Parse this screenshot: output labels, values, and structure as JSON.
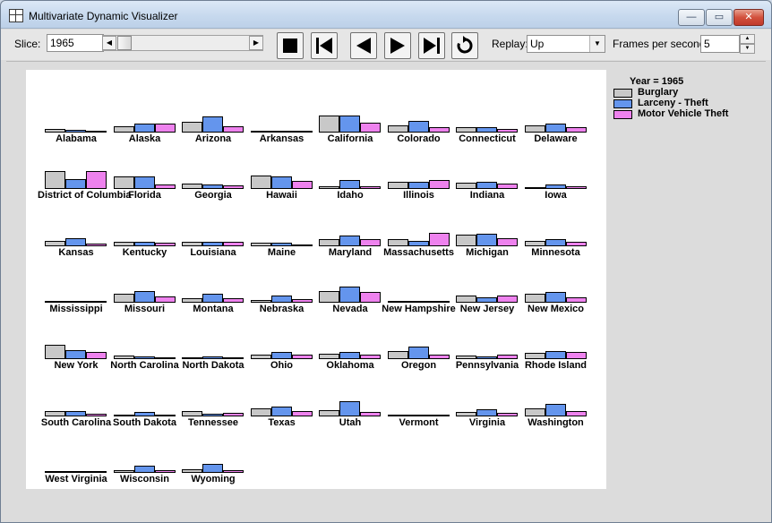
{
  "window": {
    "title": "Multivariate Dynamic Visualizer",
    "minimize_glyph": "—",
    "maximize_glyph": "▭",
    "close_glyph": "✕"
  },
  "toolbar": {
    "slice_label": "Slice:",
    "slice_value": "1965",
    "replay_label": "Replay:",
    "replay_value": "Up",
    "fps_label": "Frames per second:",
    "fps_value": "5",
    "buttons": [
      "stop",
      "first-frame",
      "step-back",
      "step-forward",
      "last-frame",
      "replay"
    ]
  },
  "legend": {
    "title": "Year = 1965",
    "items": [
      {
        "label": "Burglary",
        "color": "#c8c8c8"
      },
      {
        "label": "Larceny - Theft",
        "color": "#6495ed"
      },
      {
        "label": "Motor Vehicle Theft",
        "color": "#ee82ee"
      }
    ]
  },
  "chart_data": {
    "type": "bar",
    "note_series": [
      "Burglary",
      "Larceny - Theft",
      "Motor Vehicle Theft"
    ],
    "series_colors": [
      "#c8c8c8",
      "#6495ed",
      "#ee82ee"
    ],
    "scale_max": 1,
    "states": [
      {
        "name": "Alabama",
        "values": [
          0.22,
          0.16,
          0.05
        ]
      },
      {
        "name": "Alaska",
        "values": [
          0.36,
          0.52,
          0.48
        ]
      },
      {
        "name": "Arizona",
        "values": [
          0.58,
          0.88,
          0.36
        ]
      },
      {
        "name": "Arkansas",
        "values": [
          0.08,
          0.1,
          0.06
        ]
      },
      {
        "name": "California",
        "values": [
          0.95,
          0.95,
          0.55
        ]
      },
      {
        "name": "Colorado",
        "values": [
          0.4,
          0.64,
          0.28
        ]
      },
      {
        "name": "Connecticut",
        "values": [
          0.3,
          0.28,
          0.22
        ]
      },
      {
        "name": "Delaware",
        "values": [
          0.42,
          0.5,
          0.32
        ]
      },
      {
        "name": "District of Columbia",
        "values": [
          1.0,
          0.55,
          1.0
        ]
      },
      {
        "name": "Florida",
        "values": [
          0.72,
          0.72,
          0.26
        ]
      },
      {
        "name": "Georgia",
        "values": [
          0.32,
          0.26,
          0.2
        ]
      },
      {
        "name": "Hawaii",
        "values": [
          0.76,
          0.72,
          0.44
        ]
      },
      {
        "name": "Idaho",
        "values": [
          0.16,
          0.52,
          0.16
        ]
      },
      {
        "name": "Illinois",
        "values": [
          0.38,
          0.42,
          0.52
        ]
      },
      {
        "name": "Indiana",
        "values": [
          0.36,
          0.42,
          0.32
        ]
      },
      {
        "name": "Iowa",
        "values": [
          0.1,
          0.26,
          0.14
        ]
      },
      {
        "name": "Kansas",
        "values": [
          0.3,
          0.46,
          0.14
        ]
      },
      {
        "name": "Kentucky",
        "values": [
          0.26,
          0.26,
          0.18
        ]
      },
      {
        "name": "Louisiana",
        "values": [
          0.26,
          0.26,
          0.24
        ]
      },
      {
        "name": "Maine",
        "values": [
          0.2,
          0.2,
          0.06
        ]
      },
      {
        "name": "Maryland",
        "values": [
          0.42,
          0.62,
          0.38
        ]
      },
      {
        "name": "Massachusetts",
        "values": [
          0.38,
          0.32,
          0.76
        ]
      },
      {
        "name": "Michigan",
        "values": [
          0.66,
          0.7,
          0.44
        ]
      },
      {
        "name": "Minnesota",
        "values": [
          0.28,
          0.38,
          0.24
        ]
      },
      {
        "name": "Mississippi",
        "values": [
          0.08,
          0.06,
          0.04
        ]
      },
      {
        "name": "Missouri",
        "values": [
          0.5,
          0.64,
          0.34
        ]
      },
      {
        "name": "Montana",
        "values": [
          0.24,
          0.48,
          0.26
        ]
      },
      {
        "name": "Nebraska",
        "values": [
          0.16,
          0.42,
          0.18
        ]
      },
      {
        "name": "Nevada",
        "values": [
          0.66,
          0.9,
          0.58
        ]
      },
      {
        "name": "New Hampshire",
        "values": [
          0.1,
          0.1,
          0.06
        ]
      },
      {
        "name": "New Jersey",
        "values": [
          0.42,
          0.28,
          0.4
        ]
      },
      {
        "name": "New Mexico",
        "values": [
          0.48,
          0.6,
          0.3
        ]
      },
      {
        "name": "New York",
        "values": [
          0.8,
          0.48,
          0.38
        ]
      },
      {
        "name": "North Carolina",
        "values": [
          0.2,
          0.14,
          0.1
        ]
      },
      {
        "name": "North Dakota",
        "values": [
          0.06,
          0.16,
          0.06
        ]
      },
      {
        "name": "Ohio",
        "values": [
          0.24,
          0.4,
          0.24
        ]
      },
      {
        "name": "Oklahoma",
        "values": [
          0.3,
          0.38,
          0.24
        ]
      },
      {
        "name": "Oregon",
        "values": [
          0.44,
          0.7,
          0.26
        ]
      },
      {
        "name": "Pennsylvania",
        "values": [
          0.18,
          0.16,
          0.26
        ]
      },
      {
        "name": "Rhode Island",
        "values": [
          0.36,
          0.44,
          0.4
        ]
      },
      {
        "name": "South Carolina",
        "values": [
          0.28,
          0.28,
          0.16
        ]
      },
      {
        "name": "South Dakota",
        "values": [
          0.06,
          0.24,
          0.1
        ]
      },
      {
        "name": "Tennessee",
        "values": [
          0.3,
          0.16,
          0.2
        ]
      },
      {
        "name": "Texas",
        "values": [
          0.46,
          0.54,
          0.28
        ]
      },
      {
        "name": "Utah",
        "values": [
          0.36,
          0.86,
          0.26
        ]
      },
      {
        "name": "Vermont",
        "values": [
          0.08,
          0.05,
          0.06
        ]
      },
      {
        "name": "Virginia",
        "values": [
          0.26,
          0.42,
          0.18
        ]
      },
      {
        "name": "Washington",
        "values": [
          0.44,
          0.7,
          0.28
        ]
      },
      {
        "name": "West Virginia",
        "values": [
          0.05,
          0.05,
          0.05
        ]
      },
      {
        "name": "Wisconsin",
        "values": [
          0.14,
          0.4,
          0.16
        ]
      },
      {
        "name": "Wyoming",
        "values": [
          0.18,
          0.52,
          0.16
        ]
      }
    ]
  }
}
